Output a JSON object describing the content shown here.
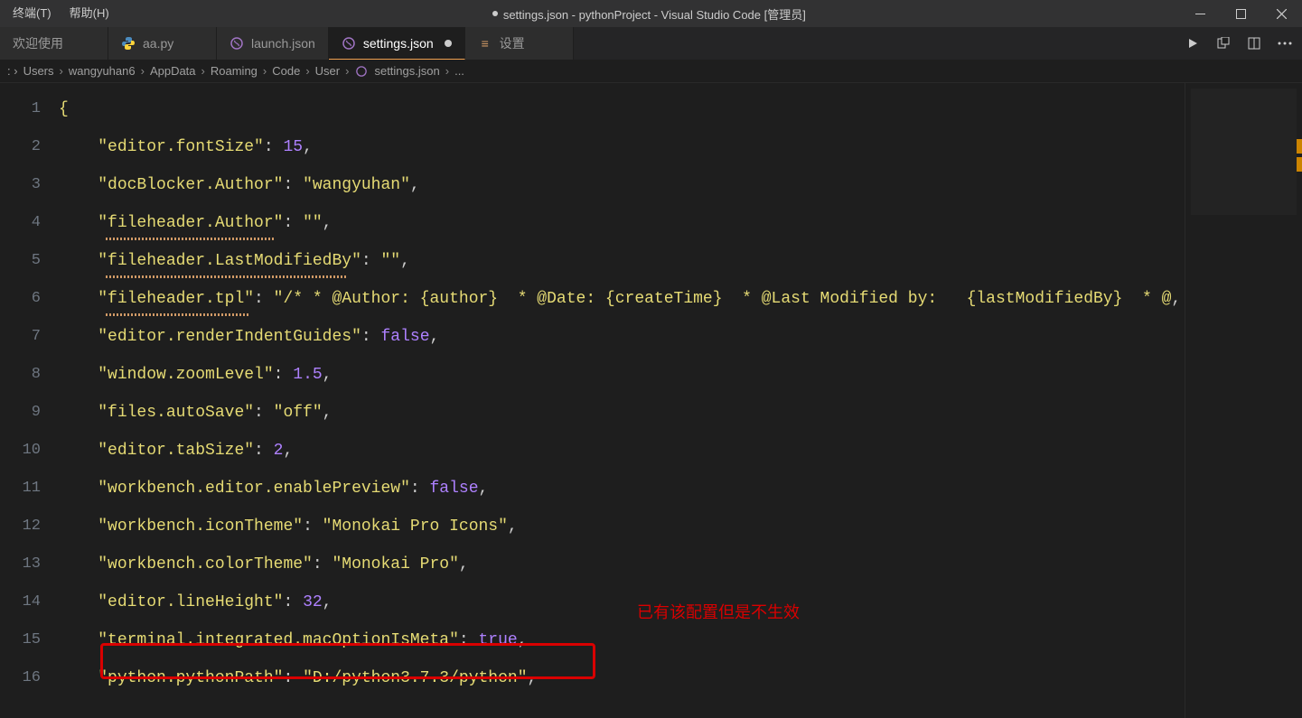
{
  "window": {
    "menus": [
      "终端(T)",
      "帮助(H)"
    ],
    "title": "settings.json - pythonProject - Visual Studio Code [管理员]"
  },
  "tabs": [
    {
      "label": "欢迎使用",
      "icon": "none",
      "modified": false
    },
    {
      "label": "aa.py",
      "icon": "python",
      "modified": false
    },
    {
      "label": "launch.json",
      "icon": "json",
      "modified": false
    },
    {
      "label": "settings.json",
      "icon": "json",
      "modified": true,
      "active": true
    },
    {
      "label": "设置",
      "icon": "settings",
      "modified": false
    }
  ],
  "breadcrumb": [
    "Users",
    "wangyuhan6",
    "AppData",
    "Roaming",
    "Code",
    "User",
    "settings.json",
    "..."
  ],
  "code": {
    "lines": [
      {
        "n": 1,
        "type": "brace",
        "content": "{"
      },
      {
        "n": 2,
        "type": "kv",
        "key": "\"editor.fontSize\"",
        "value": "15",
        "vtype": "num"
      },
      {
        "n": 3,
        "type": "kv",
        "key": "\"docBlocker.Author\"",
        "value": "\"wangyuhan\"",
        "vtype": "str"
      },
      {
        "n": 4,
        "type": "kv",
        "key": "\"fileheader.Author\"",
        "value": "\"\"",
        "vtype": "str",
        "warn": true
      },
      {
        "n": 5,
        "type": "kv",
        "key": "\"fileheader.LastModifiedBy\"",
        "value": "\"\"",
        "vtype": "str",
        "warn": true
      },
      {
        "n": 6,
        "type": "kv",
        "key": "\"fileheader.tpl\"",
        "value": "\"/* * @Author: {author}  * @Date: {createTime}  * @Last Modified by:   {lastModifiedBy}  * @",
        "vtype": "str",
        "warn": true
      },
      {
        "n": 7,
        "type": "kv",
        "key": "\"editor.renderIndentGuides\"",
        "value": "false",
        "vtype": "bool"
      },
      {
        "n": 8,
        "type": "kv",
        "key": "\"window.zoomLevel\"",
        "value": "1.5",
        "vtype": "num"
      },
      {
        "n": 9,
        "type": "kv",
        "key": "\"files.autoSave\"",
        "value": "\"off\"",
        "vtype": "str"
      },
      {
        "n": 10,
        "type": "kv",
        "key": "\"editor.tabSize\"",
        "value": "2",
        "vtype": "num"
      },
      {
        "n": 11,
        "type": "kv",
        "key": "\"workbench.editor.enablePreview\"",
        "value": "false",
        "vtype": "bool"
      },
      {
        "n": 12,
        "type": "kv",
        "key": "\"workbench.iconTheme\"",
        "value": "\"Monokai Pro Icons\"",
        "vtype": "str"
      },
      {
        "n": 13,
        "type": "kv",
        "key": "\"workbench.colorTheme\"",
        "value": "\"Monokai Pro\"",
        "vtype": "str"
      },
      {
        "n": 14,
        "type": "kv",
        "key": "\"editor.lineHeight\"",
        "value": "32",
        "vtype": "num"
      },
      {
        "n": 15,
        "type": "kv",
        "key": "\"terminal.integrated.macOptionIsMeta\"",
        "value": "true",
        "vtype": "bool"
      },
      {
        "n": 16,
        "type": "kv",
        "key": "\"python.pythonPath\"",
        "value": "\"D:/python3.7.3/python\"",
        "vtype": "str"
      }
    ]
  },
  "annotation": {
    "text": "已有该配置但是不生效"
  }
}
